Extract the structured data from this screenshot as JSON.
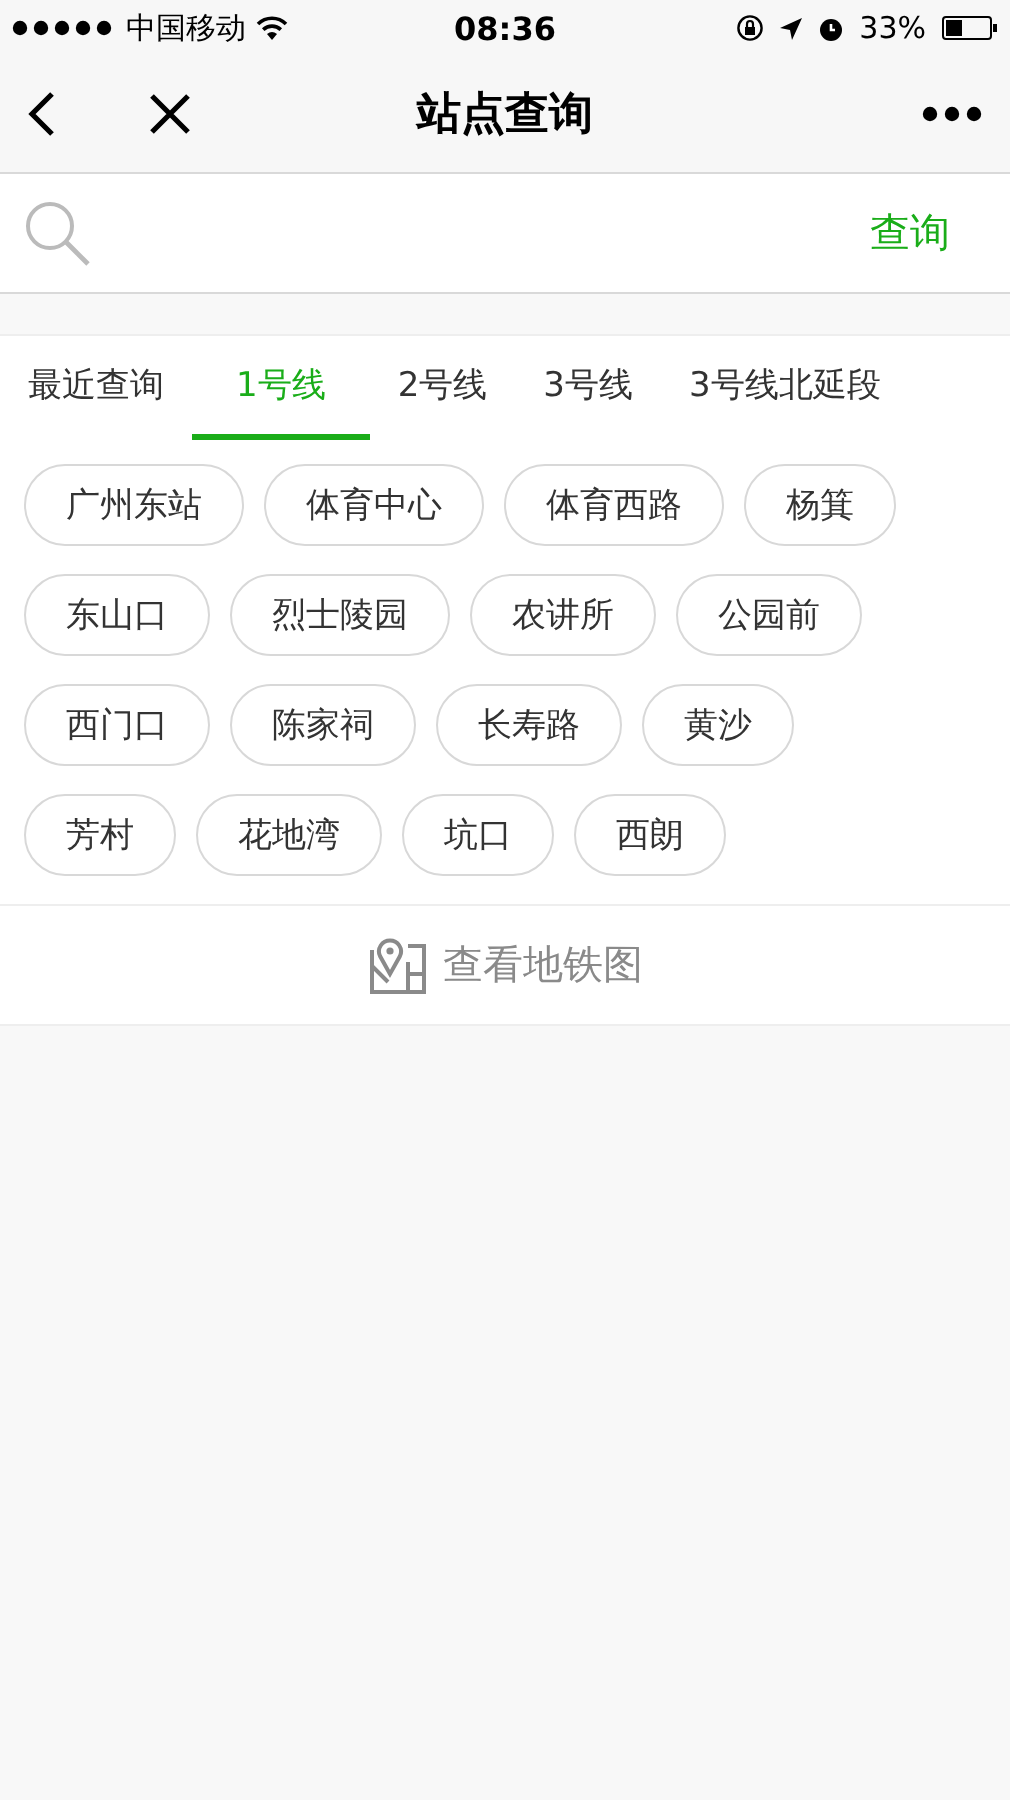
{
  "status_bar": {
    "carrier": "中国移动",
    "time": "08:36",
    "battery": "33%"
  },
  "nav_bar": {
    "title": "站点查询"
  },
  "search": {
    "button": "查询"
  },
  "tabs": [
    {
      "label": "最近查询",
      "selected": false
    },
    {
      "label": "1号线",
      "selected": true
    },
    {
      "label": "2号线",
      "selected": false
    },
    {
      "label": "3号线",
      "selected": false
    },
    {
      "label": "3号线北延段",
      "selected": false
    }
  ],
  "stations": [
    [
      "广州东站",
      "体育中心",
      "体育西路",
      "杨箕"
    ],
    [
      "东山口",
      "烈士陵园",
      "农讲所",
      "公园前"
    ],
    [
      "西门口",
      "陈家祠",
      "长寿路",
      "黄沙"
    ],
    [
      "芳村",
      "花地湾",
      "坑口",
      "西朗"
    ]
  ],
  "map_link": "查看地铁图"
}
